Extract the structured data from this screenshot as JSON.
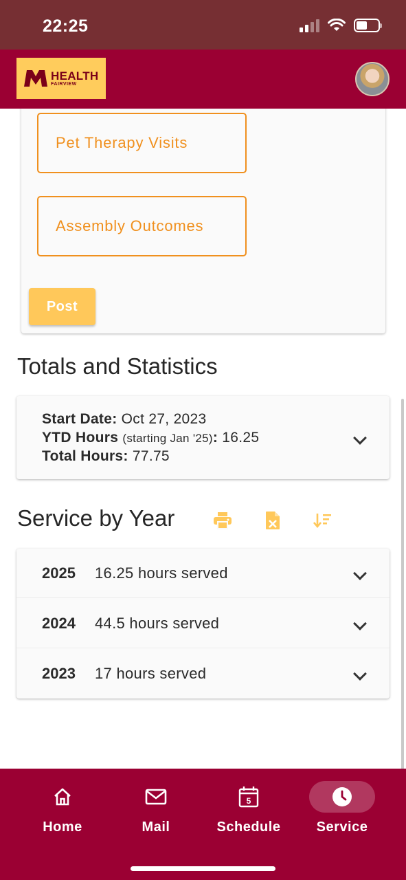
{
  "status_bar": {
    "time": "22:25"
  },
  "header": {
    "logo_health": "HEALTH",
    "logo_fairview": "FAIRVIEW"
  },
  "form": {
    "buttons": [
      "Pet Therapy Visits",
      "Assembly Outcomes"
    ],
    "post_label": "Post"
  },
  "totals": {
    "title": "Totals and Statistics",
    "start_date_label": "Start Date:",
    "start_date": "Oct 27, 2023",
    "ytd_label": "YTD Hours",
    "ytd_note": "(starting Jan '25)",
    "ytd_colon": ":",
    "ytd_value": "16.25",
    "total_label": "Total Hours:",
    "total_value": "77.75"
  },
  "service": {
    "title": "Service by Year",
    "years": [
      {
        "year": "2025",
        "hours": "16.25 hours served"
      },
      {
        "year": "2024",
        "hours": "44.5 hours served"
      },
      {
        "year": "2023",
        "hours": "17 hours served"
      }
    ]
  },
  "nav": {
    "items": [
      {
        "label": "Home",
        "icon": "home-icon"
      },
      {
        "label": "Mail",
        "icon": "mail-icon"
      },
      {
        "label": "Schedule",
        "icon": "calendar-icon",
        "badge": "5"
      },
      {
        "label": "Service",
        "icon": "clock-icon"
      }
    ],
    "active": "Service"
  },
  "colors": {
    "maroon": "#9b0033",
    "status_bar": "#762f33",
    "gold": "#ffc85a",
    "orange": "#f0901e"
  }
}
